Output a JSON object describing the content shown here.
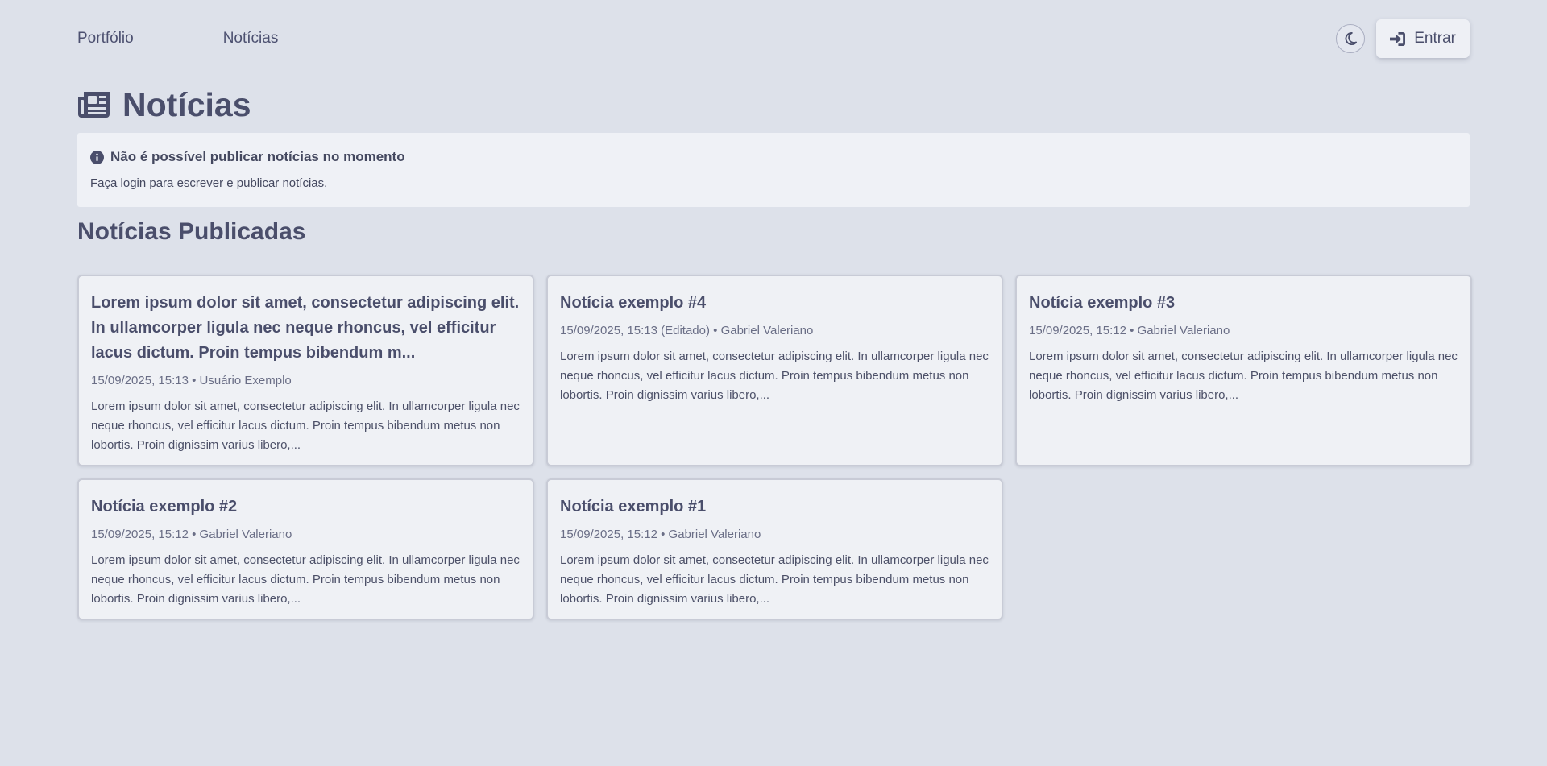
{
  "nav": {
    "links": [
      "Portfólio",
      "Notícias"
    ],
    "login_label": "Entrar"
  },
  "icons": {
    "theme": "moon-icon",
    "login": "sign-in-icon",
    "title": "newspaper-icon",
    "alert": "info-circle-icon"
  },
  "page": {
    "title": "Notícias"
  },
  "alert": {
    "title": "Não é possível publicar notícias no momento",
    "text": "Faça login para escrever e publicar notícias."
  },
  "section": {
    "title": "Notícias Publicadas"
  },
  "news": [
    {
      "title": "Lorem ipsum dolor sit amet, consectetur adipiscing elit. In ullamcorper ligula nec neque rhoncus, vel efficitur lacus dictum. Proin tempus bibendum m...",
      "meta": "15/09/2025, 15:13 • Usuário Exemplo",
      "excerpt": "Lorem ipsum dolor sit amet, consectetur adipiscing elit. In ullamcorper ligula nec neque rhoncus, vel efficitur lacus dictum. Proin tempus bibendum metus non lobortis. Proin dignissim varius libero,..."
    },
    {
      "title": "Notícia exemplo #4",
      "meta": "15/09/2025, 15:13 (Editado) • Gabriel Valeriano",
      "excerpt": "Lorem ipsum dolor sit amet, consectetur adipiscing elit. In ullamcorper ligula nec neque rhoncus, vel efficitur lacus dictum. Proin tempus bibendum metus non lobortis. Proin dignissim varius libero,..."
    },
    {
      "title": "Notícia exemplo #3",
      "meta": "15/09/2025, 15:12 • Gabriel Valeriano",
      "excerpt": "Lorem ipsum dolor sit amet, consectetur adipiscing elit. In ullamcorper ligula nec neque rhoncus, vel efficitur lacus dictum. Proin tempus bibendum metus non lobortis. Proin dignissim varius libero,..."
    },
    {
      "title": "Notícia exemplo #2",
      "meta": "15/09/2025, 15:12 • Gabriel Valeriano",
      "excerpt": "Lorem ipsum dolor sit amet, consectetur adipiscing elit. In ullamcorper ligula nec neque rhoncus, vel efficitur lacus dictum. Proin tempus bibendum metus non lobortis. Proin dignissim varius libero,..."
    },
    {
      "title": "Notícia exemplo #1",
      "meta": "15/09/2025, 15:12 • Gabriel Valeriano",
      "excerpt": "Lorem ipsum dolor sit amet, consectetur adipiscing elit. In ullamcorper ligula nec neque rhoncus, vel efficitur lacus dictum. Proin tempus bibendum metus non lobortis. Proin dignissim varius libero,..."
    }
  ],
  "colors": {
    "background": "#dde1ea",
    "card": "#eff1f5",
    "text": "#4a4e6b"
  }
}
